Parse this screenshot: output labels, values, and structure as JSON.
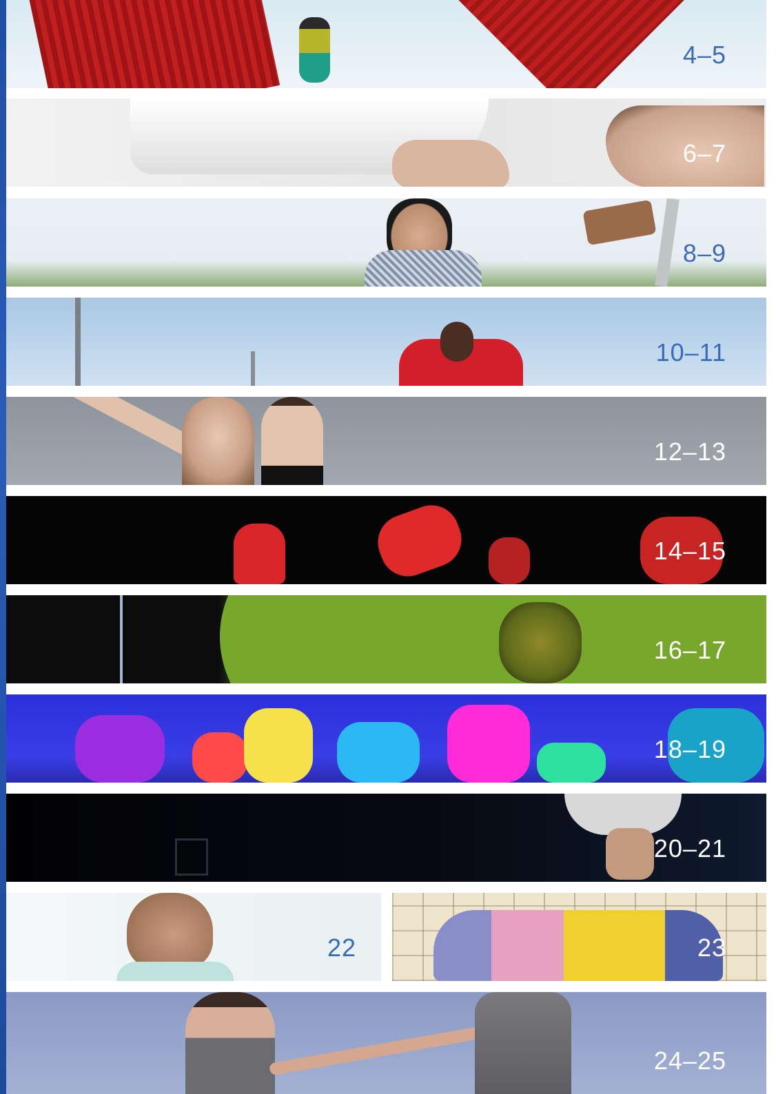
{
  "strips": [
    {
      "label": "4–5"
    },
    {
      "label": "6–7"
    },
    {
      "label": "8–9"
    },
    {
      "label": "10–11"
    },
    {
      "label": "12–13"
    },
    {
      "label": "14–15"
    },
    {
      "label": "16–17"
    },
    {
      "label": "18–19"
    },
    {
      "label": "20–21"
    },
    {
      "label": "22"
    },
    {
      "label": "23"
    },
    {
      "label": "24–25"
    }
  ],
  "colors": {
    "accent_blue": "#3a6bb8",
    "label_white": "#ffffff",
    "edge_blue": "#2b5cb8"
  }
}
